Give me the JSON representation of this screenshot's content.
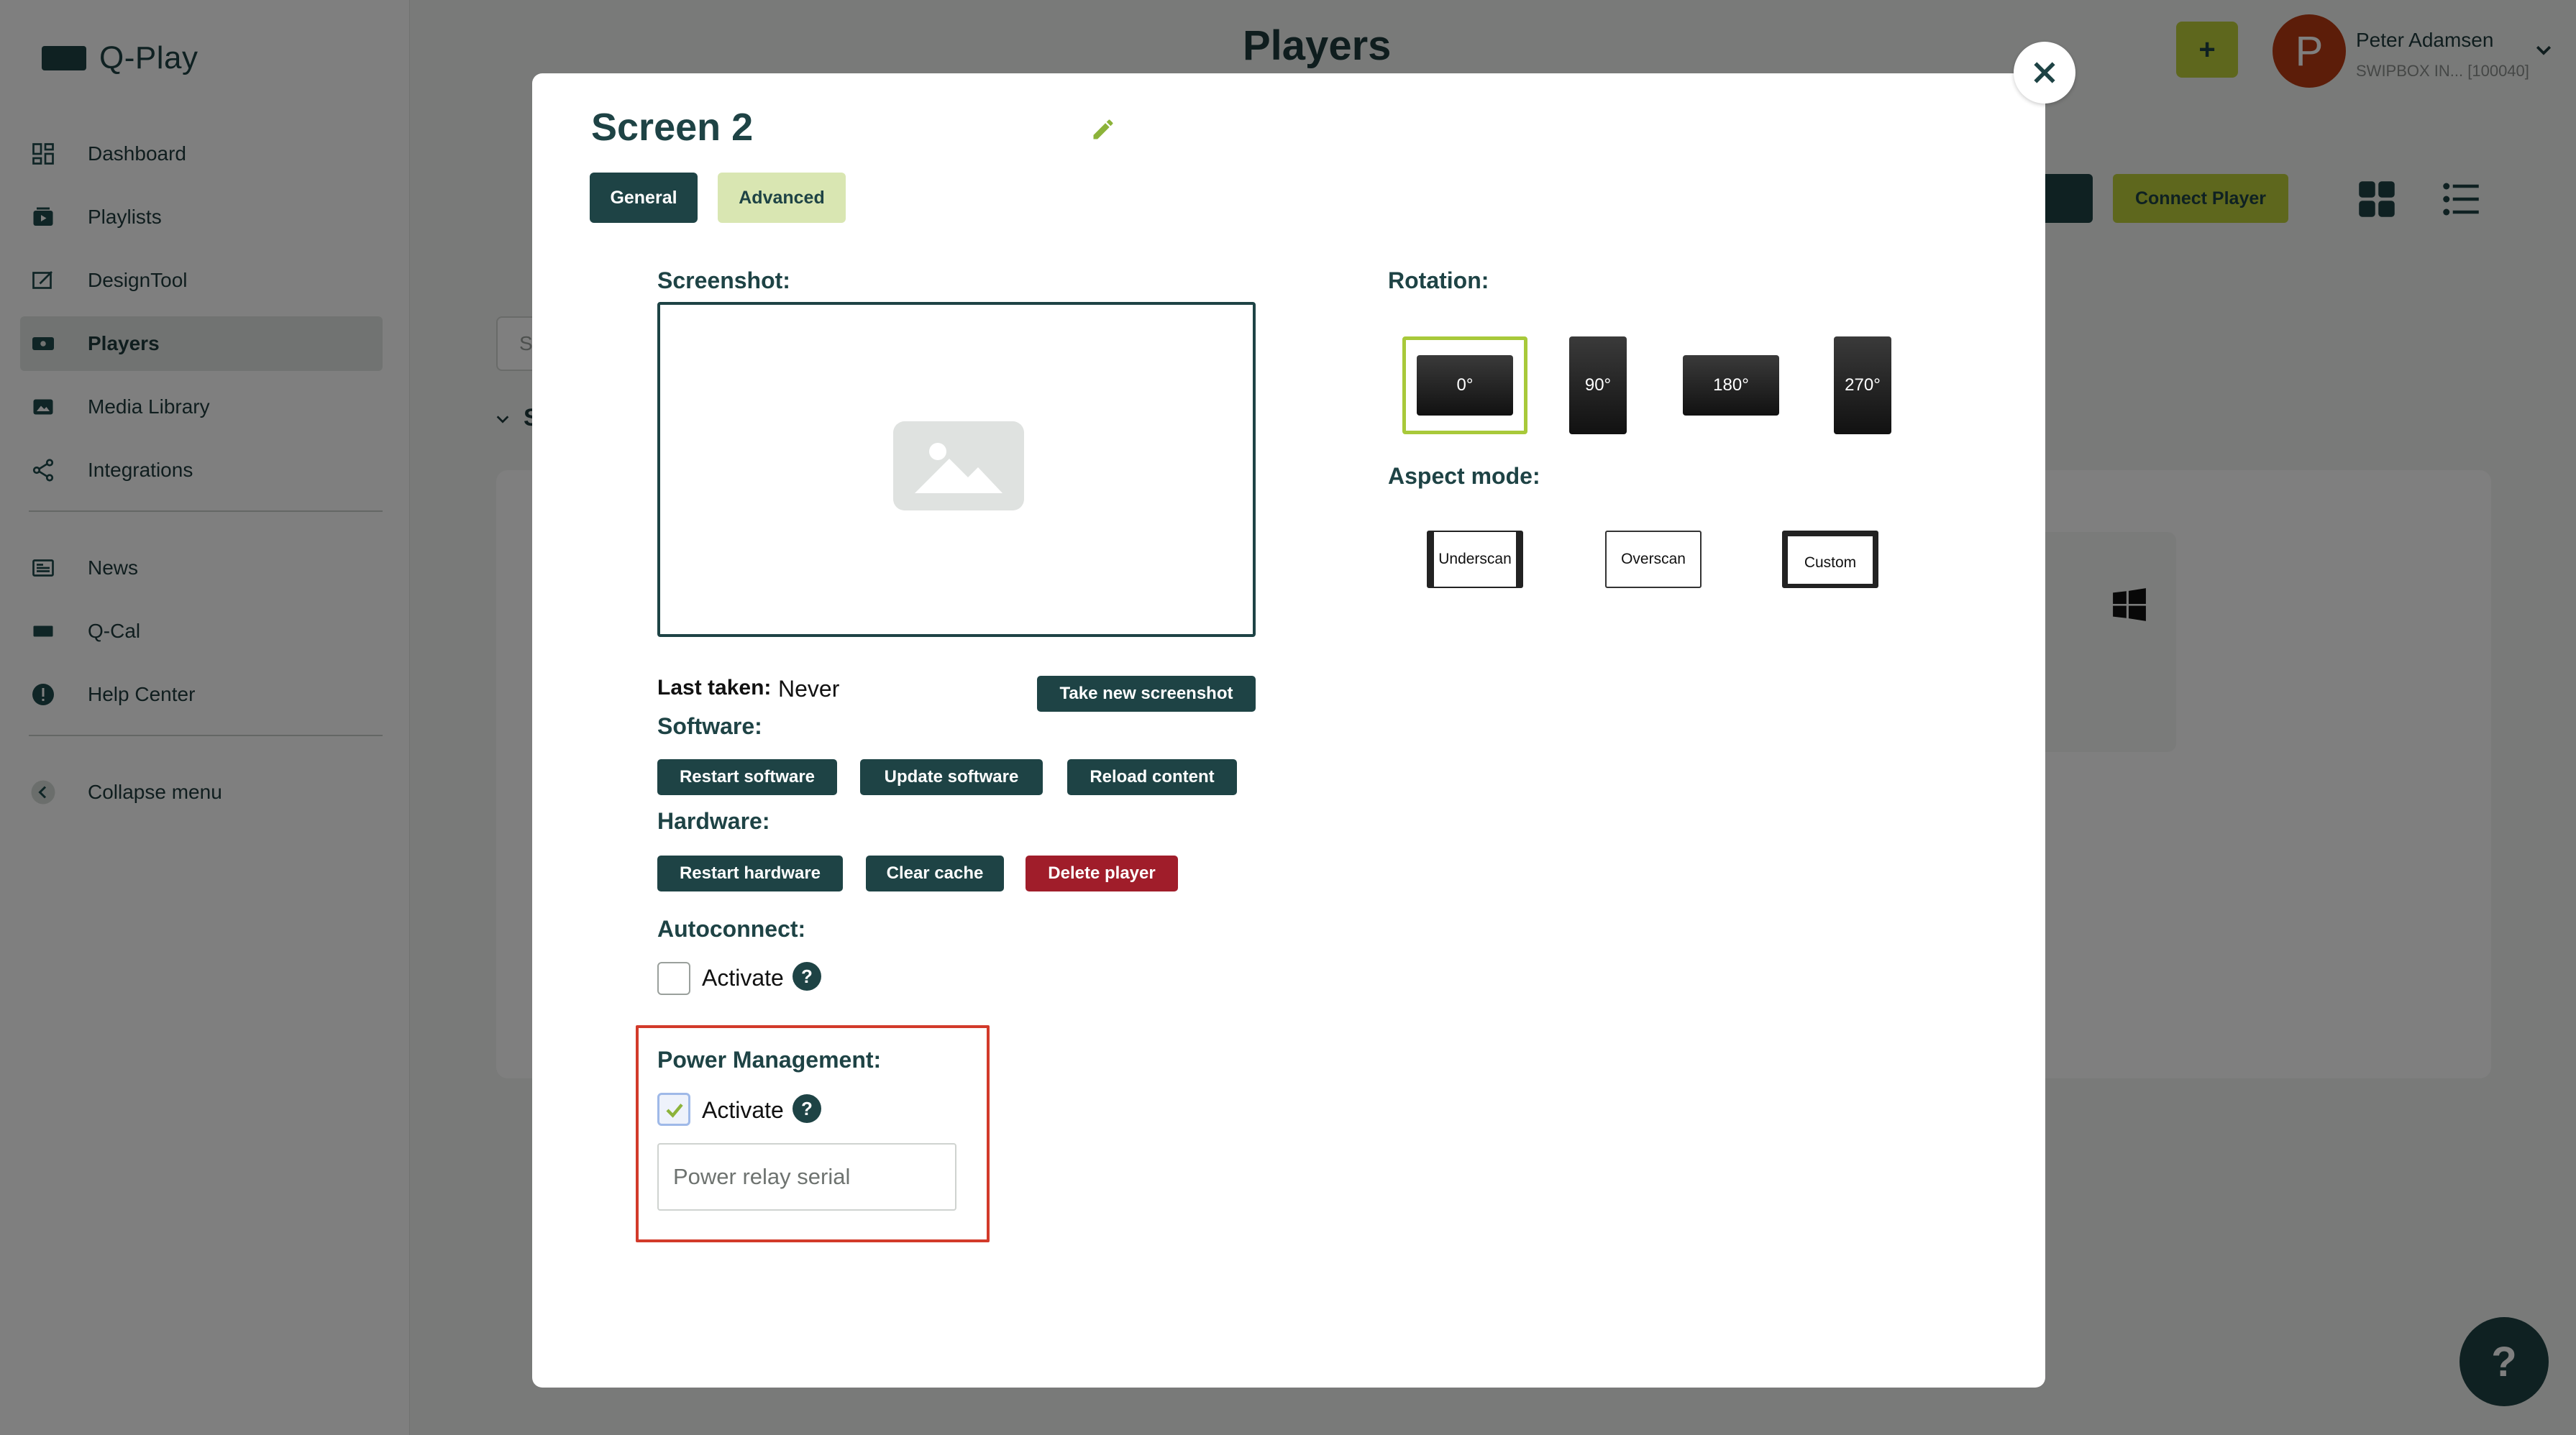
{
  "app": {
    "brand": "Q-Play",
    "page_title": "Players",
    "add_label": "+",
    "user": {
      "initial": "P",
      "name": "Peter Adamsen",
      "org": "SWIPBOX IN... [100040]"
    }
  },
  "sidebar": {
    "items": [
      {
        "label": "Dashboard",
        "icon": "dashboard-icon"
      },
      {
        "label": "Playlists",
        "icon": "playlist-icon"
      },
      {
        "label": "DesignTool",
        "icon": "design-icon"
      },
      {
        "label": "Players",
        "icon": "player-icon",
        "active": true
      },
      {
        "label": "Media Library",
        "icon": "media-icon"
      },
      {
        "label": "Integrations",
        "icon": "share-icon"
      }
    ],
    "secondary": [
      {
        "label": "News",
        "icon": "news-icon"
      },
      {
        "label": "Q-Cal",
        "icon": "calendar-icon"
      },
      {
        "label": "Help Center",
        "icon": "info-icon"
      }
    ],
    "collapse": "Collapse menu"
  },
  "toolbar": {
    "connect_player": "Connect Player",
    "search_placeholder": "S",
    "group_label": "S"
  },
  "help_fab": "?",
  "modal": {
    "title": "Screen 2",
    "tabs": {
      "general": "General",
      "advanced": "Advanced"
    },
    "screenshot": {
      "label": "Screenshot:",
      "last_taken_label": "Last taken:",
      "last_taken_value": "Never",
      "take_button": "Take new screenshot"
    },
    "software": {
      "label": "Software:",
      "restart": "Restart software",
      "update": "Update software",
      "reload": "Reload content"
    },
    "hardware": {
      "label": "Hardware:",
      "restart": "Restart hardware",
      "clear_cache": "Clear cache",
      "delete": "Delete player"
    },
    "autoconnect": {
      "label": "Autoconnect:",
      "activate": "Activate",
      "checked": false,
      "help": "?"
    },
    "power_management": {
      "label": "Power Management:",
      "activate": "Activate",
      "checked": true,
      "help": "?",
      "relay_placeholder": "Power relay serial",
      "relay_value": ""
    },
    "rotation": {
      "label": "Rotation:",
      "options": [
        "0°",
        "90°",
        "180°",
        "270°"
      ],
      "selected": "0°"
    },
    "aspect": {
      "label": "Aspect mode:",
      "options": [
        "Underscan",
        "Overscan",
        "Custom"
      ]
    }
  },
  "colors": {
    "primary": "#1e4345",
    "accent": "#bccf3a",
    "danger": "#a01d2a",
    "highlight": "#d23a2a"
  }
}
